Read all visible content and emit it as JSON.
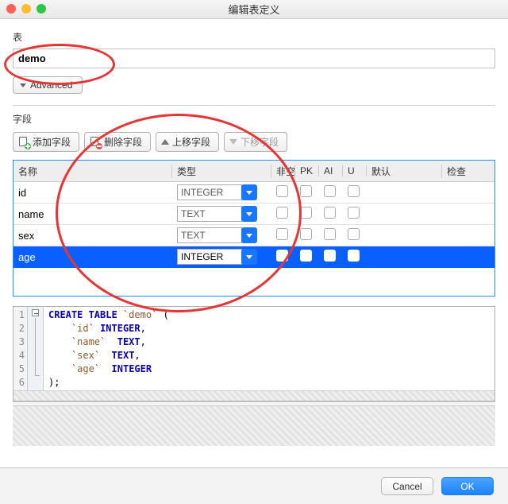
{
  "window": {
    "title": "编辑表定义"
  },
  "sections": {
    "table": "表",
    "fields": "字段"
  },
  "table_name": "demo",
  "advanced_label": "Advanced",
  "toolbar": {
    "add": "添加字段",
    "remove": "删除字段",
    "move_up": "上移字段",
    "move_down": "下移字段"
  },
  "columns": {
    "name": "名称",
    "type": "类型",
    "not_null": "非空",
    "pk": "PK",
    "ai": "AI",
    "u": "U",
    "default": "默认",
    "check": "检查"
  },
  "rows": [
    {
      "name": "id",
      "type": "INTEGER",
      "not_null": false,
      "pk": false,
      "ai": false,
      "u": false,
      "default": "",
      "selected": false
    },
    {
      "name": "name",
      "type": "TEXT",
      "not_null": false,
      "pk": false,
      "ai": false,
      "u": false,
      "default": "",
      "selected": false
    },
    {
      "name": "sex",
      "type": "TEXT",
      "not_null": false,
      "pk": false,
      "ai": false,
      "u": false,
      "default": "",
      "selected": false
    },
    {
      "name": "age",
      "type": "INTEGER",
      "not_null": false,
      "pk": false,
      "ai": false,
      "u": false,
      "default": "",
      "selected": true
    }
  ],
  "sql_lines": [
    "CREATE TABLE `demo` (",
    "    `id` INTEGER,",
    "    `name`  TEXT,",
    "    `sex`  TEXT,",
    "    `age`  INTEGER",
    ");"
  ],
  "buttons": {
    "cancel": "Cancel",
    "ok": "OK"
  }
}
